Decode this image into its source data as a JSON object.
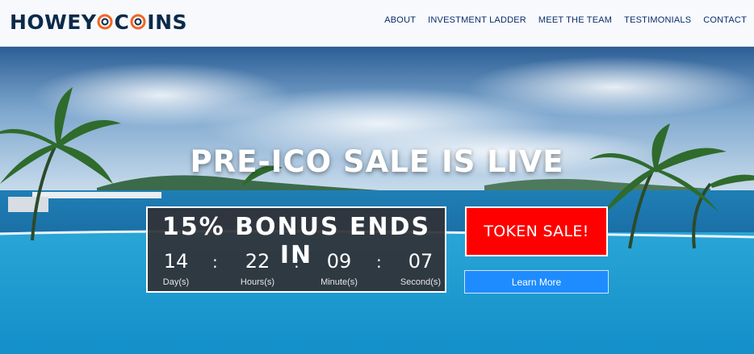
{
  "brand": {
    "logo_text_left": "HOWEY",
    "logo_text_o": "O",
    "logo_text_mid": "C",
    "logo_text_right": "INS",
    "logo_icon": "coin-icon",
    "logo_color": "#0b2a4a",
    "coin_color": "#f26522"
  },
  "nav": {
    "items": [
      {
        "label": "ABOUT"
      },
      {
        "label": "INVESTMENT LADDER"
      },
      {
        "label": "MEET THE TEAM"
      },
      {
        "label": "TESTIMONIALS"
      },
      {
        "label": "CONTACT"
      }
    ]
  },
  "hero": {
    "headline": "PRE-ICO SALE IS LIVE",
    "background": "tropical resort pool with palm trees and ocean"
  },
  "countdown": {
    "title": "15% BONUS ENDS IN",
    "units": [
      {
        "value": "14",
        "label": "Day(s)"
      },
      {
        "value": "22",
        "label": "Hours(s)"
      },
      {
        "value": "09",
        "label": "Minute(s)"
      },
      {
        "value": "07",
        "label": "Second(s)"
      }
    ],
    "separator": ":"
  },
  "cta": {
    "token_sale_label": "TOKEN SALE!",
    "learn_more_label": "Learn More",
    "token_color": "#ff0000",
    "learn_color": "#1e8cff"
  }
}
